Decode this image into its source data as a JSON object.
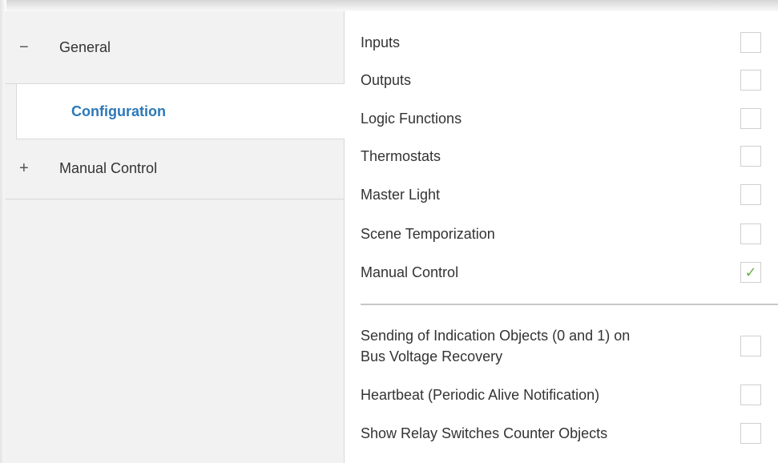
{
  "sidebar": {
    "items": [
      {
        "sign": "−",
        "label": "General"
      },
      {
        "label": "Configuration"
      },
      {
        "sign": "+",
        "label": "Manual Control"
      }
    ]
  },
  "settings": {
    "checks": [
      {
        "label": "Inputs",
        "checked": false
      },
      {
        "label": "Outputs",
        "checked": false
      },
      {
        "label": "Logic Functions",
        "checked": false
      },
      {
        "label": "Thermostats",
        "checked": false
      },
      {
        "label": "Master Light",
        "checked": false
      },
      {
        "label": "Scene Temporization",
        "checked": false
      },
      {
        "label": "Manual Control",
        "checked": true,
        "mark": "✓"
      }
    ],
    "extra": [
      {
        "label_line1": "Sending of Indication Objects (0 and 1) on",
        "label_line2": "Bus Voltage Recovery",
        "checked": false
      },
      {
        "label": "Heartbeat (Periodic Alive Notification)",
        "checked": false
      },
      {
        "label": "Show Relay Switches Counter Objects",
        "checked": false
      }
    ]
  },
  "colors": {
    "accent": "#2b78b8",
    "check": "#6ab04c",
    "sidebar_bg": "#f2f2f2"
  }
}
